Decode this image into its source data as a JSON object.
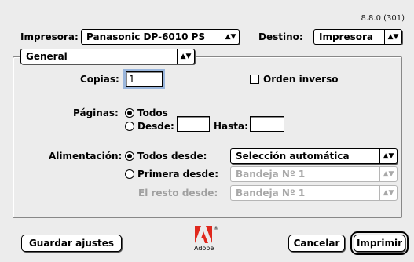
{
  "version": "8.8.0 (301)",
  "header": {
    "printer_label": "Impresora:",
    "printer_value": "Panasonic DP-6010 PS",
    "destination_label": "Destino:",
    "destination_value": "Impresora"
  },
  "section": {
    "value": "General"
  },
  "copies": {
    "label": "Copias:",
    "value": "1",
    "reverse_order_label": "Orden inverso",
    "reverse_order_checked": false
  },
  "pages": {
    "label": "Páginas:",
    "all_label": "Todos",
    "from_label": "Desde:",
    "from_value": "",
    "to_label": "Hasta:",
    "to_value": "",
    "selected": "all"
  },
  "feed": {
    "label": "Alimentación:",
    "all_from_label": "Todos desde:",
    "all_from_value": "Selección automática",
    "first_from_label": "Primera desde:",
    "first_from_value": "Bandeja Nº 1",
    "rest_from_label": "El resto desde:",
    "rest_from_value": "Bandeja Nº 1",
    "selected": "all"
  },
  "footer": {
    "save_label": "Guardar ajustes",
    "cancel_label": "Cancelar",
    "print_label": "Imprimir",
    "logo_word": "Adobe",
    "logo_reg": "®"
  },
  "icons": {
    "popup_arrows": "up-down-arrows-icon",
    "logo": "adobe-logo-icon"
  },
  "colors": {
    "focus_ring": "#9ab6dc",
    "logo_red": "#e0281d",
    "window_bg": "#ececec"
  }
}
